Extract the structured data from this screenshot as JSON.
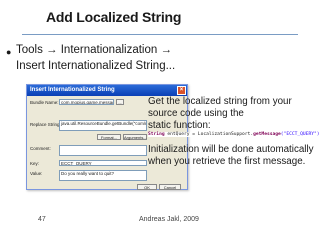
{
  "slide": {
    "title": "Add Localized String",
    "bullet_line1": "Tools → Internationalization →",
    "bullet_line2": "Insert Internationalized String...",
    "desc1_line1": "Get the localized string from your",
    "desc1_line2": "source code using the",
    "desc1_line3": "static function:",
    "code_decl": "String",
    "code_rest": " entQuery = LocalizationSupport.",
    "code_method": "getMessage",
    "code_arg": "(\"ECCT_QUERY\")",
    "code_end": ";",
    "desc2_line1": "Initialization will be done automatically",
    "desc2_line2": "when you retrieve the first message.",
    "page_number": "47",
    "author": "Andreas Jakl, 2009"
  },
  "dialog": {
    "title": "Insert Internationalized String",
    "close_glyph": "×",
    "bundle_label": "Bundle Name:",
    "bundle_value": "com.mopius.game.messages",
    "bundle_button": "...",
    "replace_label": "Replace String:",
    "replace_value": "java.util.ResourceBundle.getBundle(\"com/mopius/game",
    "format_button": "Format...",
    "arguments_button": "Arguments...",
    "comment_label": "Comment:",
    "key_label": "Key:",
    "key_value": "ECCT_QUERY",
    "value_label": "Value:",
    "value_value": "Do you really want to quit?",
    "ok_button": "OK",
    "cancel_button": "Cancel"
  }
}
